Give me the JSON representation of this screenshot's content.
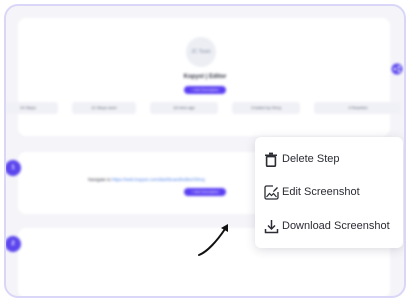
{
  "editor": {
    "avatar_text": "JC Team",
    "title": "Kopyst | Editor",
    "add_button": "+ Add Description"
  },
  "stats": [
    "24 Steps",
    "12 Steps seen",
    "18 mins ago",
    "Created by Shruj",
    "0 Reaction"
  ],
  "steps": [
    {
      "number": "1",
      "prefix": "Navigate to",
      "url": "https://web.kopyst.com/dashboard/editor/Shruj",
      "add_button": "+ Add Description"
    },
    {
      "number": "2"
    }
  ],
  "context_menu": {
    "items": [
      {
        "label": "Delete Step",
        "icon": "trash-icon"
      },
      {
        "label": "Edit Screenshot",
        "icon": "image-edit-icon"
      },
      {
        "label": "Download Screenshot",
        "icon": "download-icon"
      }
    ]
  },
  "colors": {
    "accent": "#5b45ee",
    "frame_border": "#d9d6f7",
    "canvas": "#f5f5f9",
    "link": "#4a7de8"
  }
}
